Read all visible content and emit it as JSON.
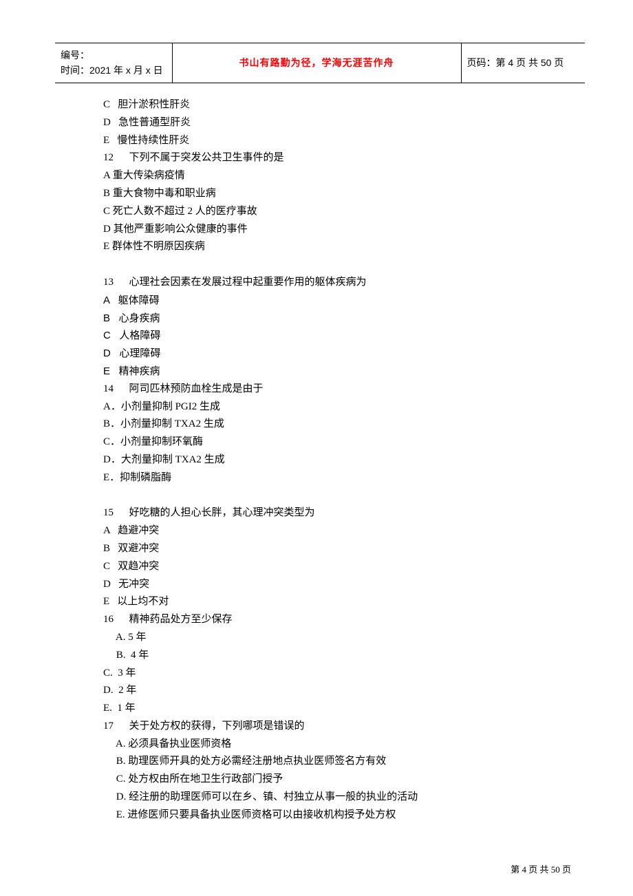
{
  "header": {
    "id_label": "编号：",
    "time_label": "时间：2021 年 x 月 x 日",
    "motto": "书山有路勤为径，学海无涯苦作舟",
    "page_label": "页码：第 4 页 共 50 页"
  },
  "body": {
    "opt_pre_c": "C   胆汁淤积性肝炎",
    "opt_pre_d": "D   急性普通型肝炎",
    "opt_pre_e": "E   慢性持续性肝炎",
    "q12": "12      下列不属于突发公共卫生事件的是",
    "q12_a": "A 重大传染病疫情",
    "q12_b": "B 重大食物中毒和职业病",
    "q12_c": "C 死亡人数不超过 2 人的医疗事故",
    "q12_d": "D 其他严重影响公众健康的事件",
    "q12_e": "E 群体性不明原因疾病",
    "q13": "13      心理社会因素在发展过程中起重要作用的躯体疾病为",
    "q13_a": "A   躯体障碍",
    "q13_b": "B   心身疾病",
    "q13_c": "C   人格障碍",
    "q13_d": "D   心理障碍",
    "q13_e": "E   精神疾病",
    "q14": "14      阿司匹林预防血栓生成是由于",
    "q14_a": "A．小剂量抑制 PGI2 生成",
    "q14_b": "B．小剂量抑制 TXA2 生成",
    "q14_c": "C．小剂量抑制环氧酶",
    "q14_d": "D．大剂量抑制 TXA2 生成",
    "q14_e": "E．抑制磷脂酶",
    "q15": "15      好吃糖的人担心长胖，其心理冲突类型为",
    "q15_a": "A   趋避冲突",
    "q15_b": "B   双避冲突",
    "q15_c": "C   双趋冲突",
    "q15_d": "D   无冲突",
    "q15_e": "E   以上均不对",
    "q16": "16      精神药品处方至少保存",
    "q16_a": "     A. 5 年",
    "q16_b": "     B.  4 年",
    "q16_c": "C.  3 年",
    "q16_d": "D.  2 年",
    "q16_e": "E.  1 年",
    "q17": "17      关于处方权的获得，下列哪项是错误的",
    "q17_a": "     A. 必须具备执业医师资格",
    "q17_b": "     B. 助理医师开具的处方必需经注册地点执业医师签名方有效",
    "q17_c": "     C. 处方权由所在地卫生行政部门授予",
    "q17_d": "     D. 经注册的助理医师可以在乡、镇、村独立从事一般的执业的活动",
    "q17_e": "     E. 进修医师只要具备执业医师资格可以由接收机构授予处方权"
  },
  "footer": {
    "text": "第 4 页 共 50 页"
  }
}
